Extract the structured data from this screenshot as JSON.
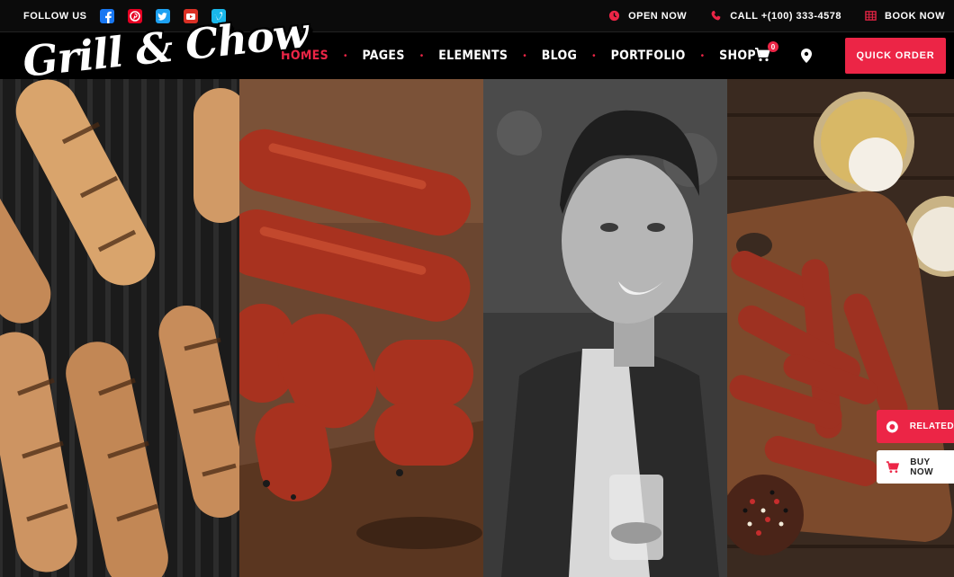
{
  "topbar": {
    "follow_label": "FOLLOW US",
    "social": [
      {
        "name": "facebook-icon",
        "color": "#1877f2"
      },
      {
        "name": "pinterest-icon",
        "color": "#e60023"
      },
      {
        "name": "twitter-icon",
        "color": "#1da1f2"
      },
      {
        "name": "youtube-icon",
        "color": "#d93025"
      },
      {
        "name": "vimeo-icon",
        "color": "#19b7ea"
      }
    ],
    "open_label": "OPEN NOW",
    "call_label": "CALL +(100) 333-4578",
    "book_label": "BOOK NOW"
  },
  "brand": {
    "logo_text": "Grill & Chow",
    "accent": "#ec2546"
  },
  "nav": {
    "items": [
      {
        "label": "HOMES",
        "active": true
      },
      {
        "label": "PAGES",
        "active": false
      },
      {
        "label": "ELEMENTS",
        "active": false
      },
      {
        "label": "BLOG",
        "active": false
      },
      {
        "label": "PORTFOLIO",
        "active": false
      },
      {
        "label": "SHOP",
        "active": false
      }
    ],
    "cart_count": "0",
    "quick_order_label": "QUICK ORDER"
  },
  "side": {
    "related_label": "RELATED",
    "buy_now_label": "BUY NOW"
  }
}
